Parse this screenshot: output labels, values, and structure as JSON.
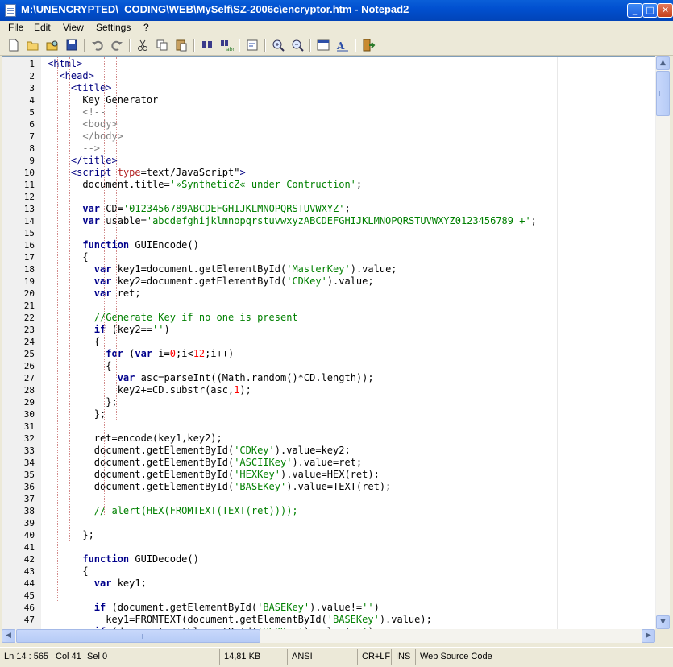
{
  "window": {
    "title": "M:\\UNENCRYPTED\\_CODING\\WEB\\MySelf\\SZ-2006c\\encryptor.htm - Notepad2",
    "min_glyph": "_",
    "max_glyph": "□",
    "close_glyph": "✕"
  },
  "menu": [
    "File",
    "Edit",
    "View",
    "Settings",
    "?"
  ],
  "toolbar": [
    "new-icon",
    "open-icon",
    "browse-icon",
    "save-icon",
    "undo-icon",
    "redo-icon",
    "cut-icon",
    "copy-icon",
    "paste-icon",
    "find-icon",
    "replace-icon",
    "word-wrap-icon",
    "zoom-in-icon",
    "zoom-out-icon",
    "select-scheme-icon",
    "customize-scheme-icon",
    "exit-icon"
  ],
  "line_numbers": [
    "1",
    "2",
    "3",
    "4",
    "5",
    "6",
    "7",
    "8",
    "9",
    "10",
    "11",
    "12",
    "13",
    "14",
    "15",
    "16",
    "17",
    "18",
    "19",
    "20",
    "21",
    "22",
    "23",
    "24",
    "25",
    "26",
    "27",
    "28",
    "29",
    "30",
    "31",
    "32",
    "33",
    "34",
    "35",
    "36",
    "37",
    "38",
    "39",
    "40",
    "41",
    "42",
    "43",
    "44",
    "45",
    "46",
    "47"
  ],
  "code": [
    "<html>",
    "  <head>",
    "    <title>",
    "      Key Generator",
    "      <!--",
    "      <body>",
    "      </body>",
    "      -->",
    "    </title>",
    "    <script type=\"text/JavaScript\">",
    "      document.title='»SyntheticZ« under Contruction';",
    "",
    "      var CD='0123456789ABCDEFGHIJKLMNOPQRSTUVWXYZ';",
    "      var usable='abcdefghijklmnopqrstuvwxyzABCDEFGHIJKLMNOPQRSTUVWXYZ0123456789_+';",
    "",
    "      function GUIEncode()",
    "      {",
    "        var key1=document.getElementById('MasterKey').value;",
    "        var key2=document.getElementById('CDKey').value;",
    "        var ret;",
    "",
    "        //Generate Key if no one is present",
    "        if (key2=='')",
    "        {",
    "          for (var i=0;i<12;i++)",
    "          {",
    "            var asc=parseInt((Math.random()*CD.length));",
    "            key2+=CD.substr(asc,1);",
    "          };",
    "        };",
    "",
    "        ret=encode(key1,key2);",
    "        document.getElementById('CDKey').value=key2;",
    "        document.getElementById('ASCIIKey').value=ret;",
    "        document.getElementById('HEXKey').value=HEX(ret);",
    "        document.getElementById('BASEKey').value=TEXT(ret);",
    "",
    "        // alert(HEX(FROMTEXT(TEXT(ret))));",
    "",
    "      };",
    "",
    "      function GUIDecode()",
    "      {",
    "        var key1;",
    "",
    "        if (document.getElementById('BASEKey').value!='')",
    "          key1=FROMTEXT(document.getElementById('BASEKey').value);"
  ],
  "cut_line": "        if (document.getElementById('HEXKey').value!='')",
  "status": {
    "position": "Ln 14 : 565",
    "column": "Col 41",
    "selection": "Sel 0",
    "size": "14,81 KB",
    "encoding": "ANSI",
    "eol": "CR+LF",
    "ovr": "INS",
    "scheme": "Web Source Code"
  }
}
